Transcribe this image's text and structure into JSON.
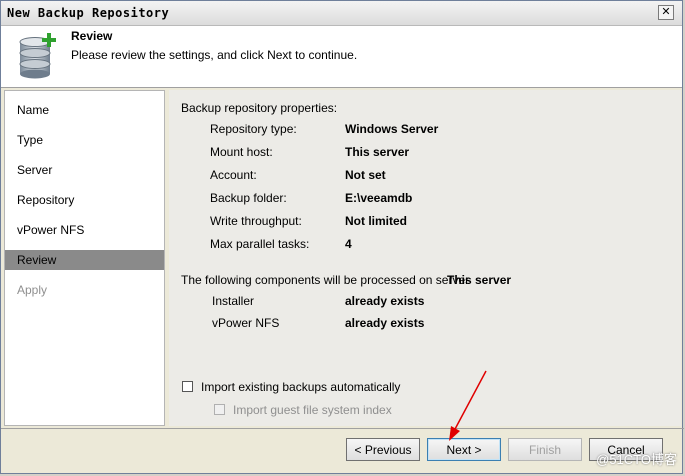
{
  "window": {
    "title": "New Backup Repository",
    "close_label": "✕"
  },
  "header": {
    "title": "Review",
    "subtitle": "Please review the settings, and click Next to continue."
  },
  "sidebar": {
    "items": [
      {
        "label": "Name"
      },
      {
        "label": "Type"
      },
      {
        "label": "Server"
      },
      {
        "label": "Repository"
      },
      {
        "label": "vPower NFS"
      },
      {
        "label": "Review"
      },
      {
        "label": "Apply"
      }
    ]
  },
  "properties": {
    "heading": "Backup repository properties:",
    "rows": [
      {
        "label": "Repository type:",
        "value": "Windows Server"
      },
      {
        "label": "Mount host:",
        "value": "This server"
      },
      {
        "label": "Account:",
        "value": "Not set"
      },
      {
        "label": "Backup folder:",
        "value": "E:\\veeamdb"
      },
      {
        "label": "Write throughput:",
        "value": "Not limited"
      },
      {
        "label": "Max parallel tasks:",
        "value": "4"
      }
    ]
  },
  "components": {
    "heading": "The following components will be processed on server",
    "server": "This server",
    "rows": [
      {
        "label": "Installer",
        "value": "already exists"
      },
      {
        "label": "vPower NFS",
        "value": "already exists"
      }
    ]
  },
  "options": {
    "import_backups": "Import existing backups automatically",
    "import_guest_index": "Import guest file system index"
  },
  "buttons": {
    "previous": "< Previous",
    "next": "Next >",
    "finish": "Finish",
    "cancel": "Cancel"
  },
  "watermark": "@51CTO博客"
}
